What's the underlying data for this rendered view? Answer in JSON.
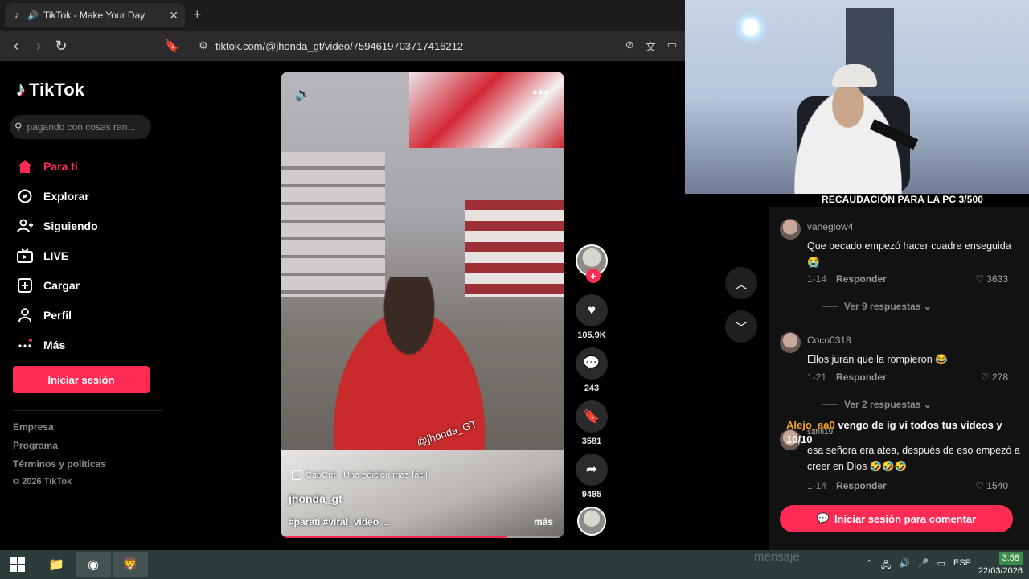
{
  "browser": {
    "tab_title": "TikTok - Make Your Day",
    "tab_close": "✕",
    "new_tab": "+",
    "url": "tiktok.com/@jhonda_gt/video/7594619703717416212"
  },
  "sidebar": {
    "logo_text": "TikTok",
    "search_placeholder": "pagando con cosas ran...",
    "nav": [
      {
        "label": "Para ti",
        "icon": "home-icon",
        "active": true
      },
      {
        "label": "Explorar",
        "icon": "compass-icon"
      },
      {
        "label": "Siguiendo",
        "icon": "following-icon"
      },
      {
        "label": "LIVE",
        "icon": "live-tv-icon"
      },
      {
        "label": "Cargar",
        "icon": "upload-icon"
      },
      {
        "label": "Perfil",
        "icon": "profile-icon"
      },
      {
        "label": "Más",
        "icon": "more-dots-icon"
      }
    ],
    "login_label": "Iniciar sesión",
    "footer": [
      "Empresa",
      "Programa",
      "Términos y políticas",
      "© 2026 TikTok"
    ]
  },
  "video": {
    "watermark": "@jhonda_GT",
    "capcut_text": "CapCut · Una edición más fácil",
    "author": "jhonda_gt",
    "caption": "#parati #viral_video ...",
    "more_label": "más",
    "progress": 0.8
  },
  "actions": {
    "likes": "105.9K",
    "comments": "243",
    "saves": "3581",
    "shares": "9485"
  },
  "stream": {
    "goal_text": "RECAUDACIÓN PARA LA PC 3/500"
  },
  "comments": [
    {
      "user": "vaneglow4",
      "text": "Que pecado empezó hacer cuadre enseguida 😭",
      "date": "1-14",
      "reply": "Responder",
      "likes": "3633",
      "more": "Ver 9 respuestas ⌄"
    },
    {
      "user": "Coco0318",
      "text": "Ellos juran que la rompieron 😂",
      "date": "1-21",
      "reply": "Responder",
      "likes": "278",
      "more": "Ver 2 respuestas ⌄"
    },
    {
      "user": "santi19",
      "text": "esa señora era atea, después de eso empezó a creer en Dios 🤣🤣🤣",
      "date": "1-14",
      "reply": "Responder",
      "likes": "1540"
    }
  ],
  "chat_overlay": {
    "user": "Alejo_aa0",
    "message": "vengo de ig vi todos tus videos y 10/10"
  },
  "comment_login_label": "Iniciar sesión para comentar",
  "taskbar": {
    "ghost_text": "mensaje",
    "language": "ESP",
    "time": "3:58",
    "date": "22/03/2026"
  }
}
